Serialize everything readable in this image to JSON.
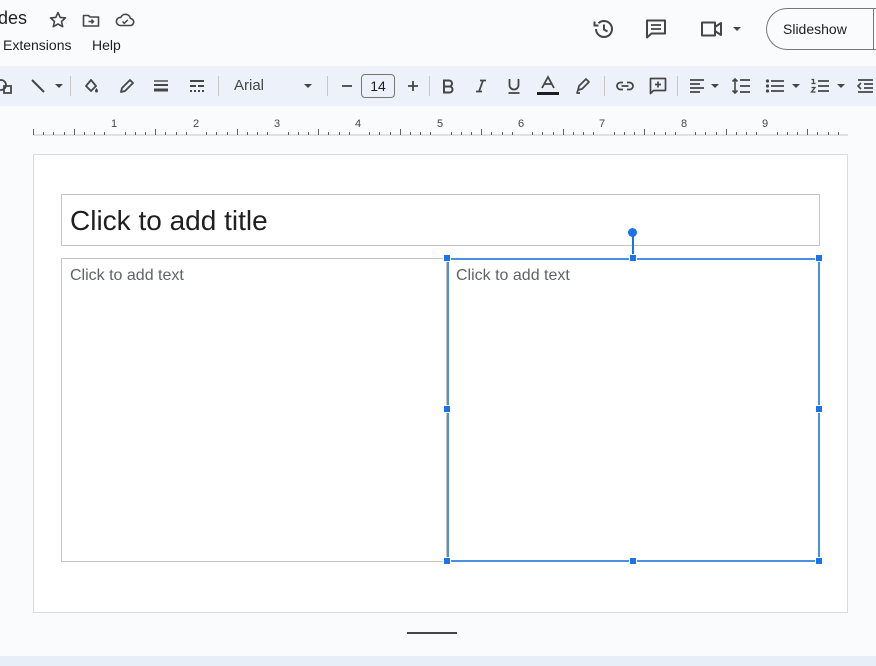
{
  "doc": {
    "title": "des"
  },
  "menu": {
    "extensions": "Extensions",
    "help": "Help"
  },
  "header": {
    "slideshow_label": "Slideshow"
  },
  "toolbar": {
    "font_name": "Arial",
    "font_size": "14"
  },
  "ruler": {
    "marks": [
      "1",
      "2",
      "3",
      "4",
      "5",
      "6",
      "7",
      "8",
      "9"
    ]
  },
  "slide": {
    "title_placeholder": "Click to add title",
    "left_placeholder": "Click to add text",
    "right_placeholder": "Click to add text"
  },
  "colors": {
    "accent": "#1a73e8",
    "selection": "#4a8fe0",
    "toolbar_bg": "#edf2fa",
    "page_bg": "#f9fbfd"
  }
}
